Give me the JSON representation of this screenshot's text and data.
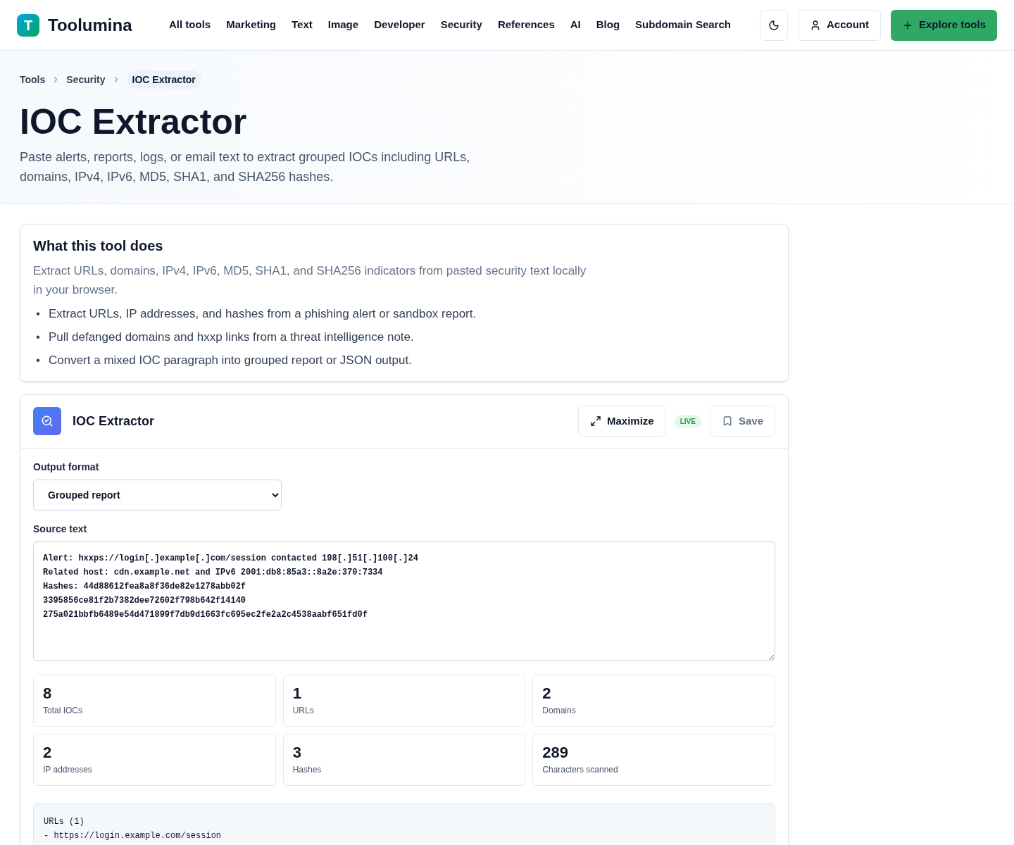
{
  "brand": {
    "logo_letter": "T",
    "name": "Toolumina"
  },
  "nav": [
    "All tools",
    "Marketing",
    "Text",
    "Image",
    "Developer",
    "Security",
    "References",
    "AI",
    "Blog",
    "Subdomain Search"
  ],
  "header_actions": {
    "account": "Account",
    "explore": "Explore tools"
  },
  "breadcrumbs": [
    {
      "label": "Tools",
      "current": false
    },
    {
      "label": "Security",
      "current": false
    },
    {
      "label": "IOC Extractor",
      "current": true
    }
  ],
  "title": "IOC Extractor",
  "subtitle": "Paste alerts, reports, logs, or email text to extract grouped IOCs including URLs, domains, IPv4, IPv6, MD5, SHA1, and SHA256 hashes.",
  "about": {
    "heading": "What this tool does",
    "description": "Extract URLs, domains, IPv4, IPv6, MD5, SHA1, and SHA256 indicators from pasted security text locally in your browser.",
    "bullets": [
      {
        "marker": "•",
        "text": "Extract URLs, IP addresses, and hashes from a phishing alert or sandbox report."
      },
      {
        "marker": "•",
        "text": "Pull defanged domains and hxxp links from a threat intelligence note."
      },
      {
        "marker": "•",
        "text": "Convert a mixed IOC paragraph into grouped report or JSON output."
      }
    ]
  },
  "tool": {
    "name": "IOC Extractor",
    "maximize": "Maximize",
    "live_badge": "LIVE",
    "save": "Save",
    "output_format": {
      "label": "Output format",
      "value": "Grouped report"
    },
    "source": {
      "label": "Source text",
      "lines": [
        "Alert: hxxps://login[.]example[.]com/session contacted 198[.]51[.]100[.]24",
        "Related host: cdn.example.net and IPv6 2001:db8:85a3::8a2e:370:7334",
        "Hashes: 44d88612fea8a8f36de82e1278abb02f",
        "3395856ce81f2b7382dee72602f798b642f14140",
        "275a021bbfb6489e54d471899f7db9d1663fc695ec2fe2a2c4538aabf651fd0f"
      ]
    },
    "stats": [
      {
        "value": "8",
        "label": "Total IOCs"
      },
      {
        "value": "1",
        "label": "URLs"
      },
      {
        "value": "2",
        "label": "Domains"
      },
      {
        "value": "2",
        "label": "IP addresses"
      },
      {
        "value": "3",
        "label": "Hashes"
      },
      {
        "value": "289",
        "label": "Characters scanned"
      }
    ],
    "output_lines": [
      "URLs (1)",
      "- https://login.example.com/session"
    ]
  }
}
